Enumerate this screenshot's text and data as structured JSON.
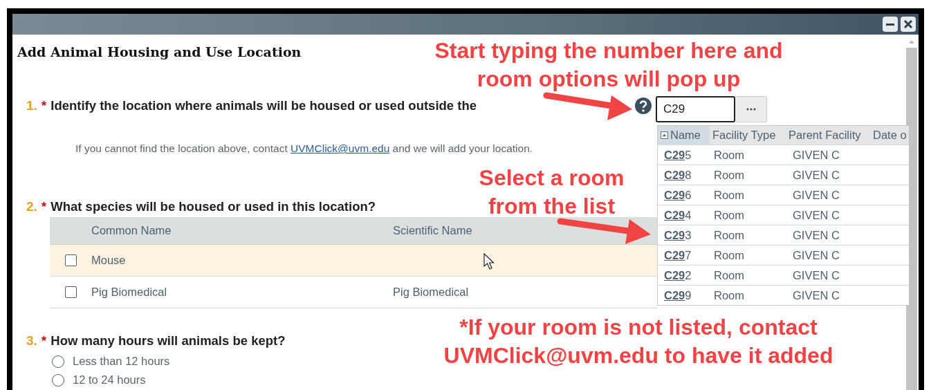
{
  "heading": "Add Animal Housing and Use Location",
  "question_1": {
    "number": "1.",
    "required_mark": "*",
    "text": "Identify the location where animals will be housed or used outside the",
    "lookup": {
      "value": "C29",
      "columns": [
        "Name",
        "Facility Type",
        "Parent Facility",
        "Date o"
      ],
      "rows": [
        {
          "name": "**C29**5",
          "facility_type": "Room",
          "parent_facility": "GIVEN C"
        },
        {
          "name": "**C29**8",
          "facility_type": "Room",
          "parent_facility": "GIVEN C"
        },
        {
          "name": "**C29**6",
          "facility_type": "Room",
          "parent_facility": "GIVEN C"
        },
        {
          "name": "**C29**4",
          "facility_type": "Room",
          "parent_facility": "GIVEN C"
        },
        {
          "name": "**C29**3",
          "facility_type": "Room",
          "parent_facility": "GIVEN C"
        },
        {
          "name": "**C29**7",
          "facility_type": "Room",
          "parent_facility": "GIVEN C"
        },
        {
          "name": "**C29**2",
          "facility_type": "Room",
          "parent_facility": "GIVEN C"
        },
        {
          "name": "**C29**9",
          "facility_type": "Room",
          "parent_facility": "GIVEN C"
        }
      ]
    },
    "hint": {
      "before": "If you cannot find the location above, contact ",
      "link": "UVMClick@uvm.edu",
      "after": " and we will add your location."
    }
  },
  "question_2": {
    "number": "2.",
    "required_mark": "*",
    "text": "What species will be housed or used in this location?",
    "columns": [
      "Common Name",
      "Scientific Name"
    ],
    "rows": [
      {
        "common_name": "Mouse",
        "checked": false,
        "hovered": true
      },
      {
        "common_name": "Pig Biomedical",
        "scientific_name": "Pig Biomedical",
        "checked": false,
        "hovered": false
      }
    ]
  },
  "question_3": {
    "number": "3.",
    "required_mark": "*",
    "text": "How many hours will animals be kept?",
    "options": [
      {
        "label": "Less than 12 hours",
        "selected": false
      },
      {
        "label": "12 to 24 hours",
        "selected": false
      }
    ]
  },
  "annotations": [
    {
      "text": "Start typing the number here and room options will pop up"
    },
    {
      "text": "Select a room from the list"
    },
    {
      "text": "*If your room is not listed, contact UVMClick@uvm.edu to have it added"
    }
  ]
}
